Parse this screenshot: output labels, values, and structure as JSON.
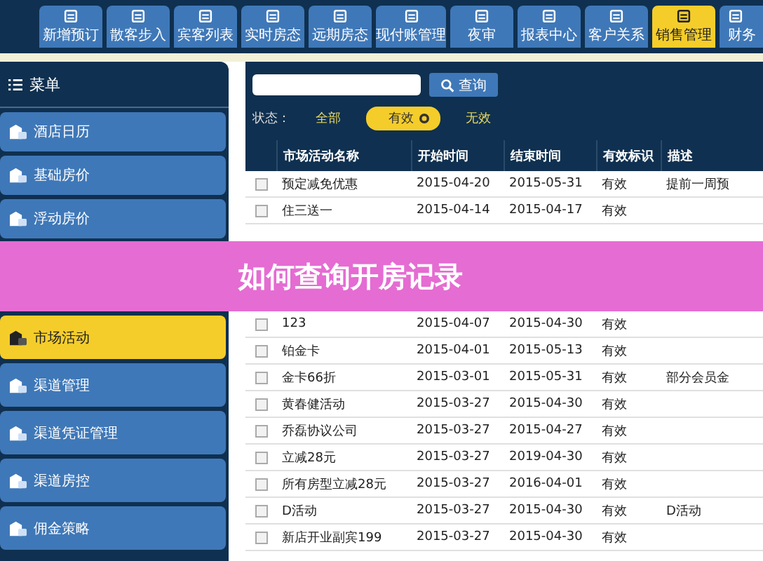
{
  "top_tabs": [
    {
      "label": "新增预订",
      "selected": false
    },
    {
      "label": "散客步入",
      "selected": false
    },
    {
      "label": "宾客列表",
      "selected": false
    },
    {
      "label": "实时房态",
      "selected": false
    },
    {
      "label": "远期房态",
      "selected": false
    },
    {
      "label": "现付账管理",
      "selected": false
    },
    {
      "label": "夜审",
      "selected": false
    },
    {
      "label": "报表中心",
      "selected": false
    },
    {
      "label": "客户关系",
      "selected": false
    },
    {
      "label": "销售管理",
      "selected": true
    },
    {
      "label": "财务",
      "selected": false
    }
  ],
  "sidebar": {
    "title": "菜单",
    "items": [
      {
        "label": "酒店日历",
        "selected": false
      },
      {
        "label": "基础房价",
        "selected": false
      },
      {
        "label": "浮动房价",
        "selected": false
      },
      {
        "label": "市场活动",
        "selected": true
      },
      {
        "label": "渠道管理",
        "selected": false
      },
      {
        "label": "渠道凭证管理",
        "selected": false
      },
      {
        "label": "渠道房控",
        "selected": false
      },
      {
        "label": "佣金策略",
        "selected": false
      }
    ]
  },
  "search": {
    "button": "查询"
  },
  "status_filter": {
    "label": "状态：",
    "options": [
      {
        "label": "全部",
        "selected": false
      },
      {
        "label": "有效",
        "selected": true
      },
      {
        "label": "无效",
        "selected": false
      }
    ]
  },
  "table": {
    "columns": [
      "市场活动名称",
      "开始时间",
      "结束时间",
      "有效标识",
      "描述"
    ],
    "rows": [
      {
        "checked": false,
        "cells": [
          "预定减免优惠",
          "2015-04-20",
          "2015-05-31",
          "有效",
          "提前一周预"
        ]
      },
      {
        "checked": false,
        "cells": [
          "住三送一",
          "2015-04-14",
          "2015-04-17",
          "有效",
          ""
        ]
      },
      {
        "checked": false,
        "cells": [
          "123",
          "2015-04-07",
          "2015-04-30",
          "有效",
          ""
        ]
      },
      {
        "checked": false,
        "cells": [
          "铂金卡",
          "2015-04-01",
          "2015-05-13",
          "有效",
          ""
        ]
      },
      {
        "checked": false,
        "cells": [
          "金卡66折",
          "2015-03-01",
          "2015-05-31",
          "有效",
          "部分会员金"
        ]
      },
      {
        "checked": false,
        "cells": [
          "黄春健活动",
          "2015-03-27",
          "2015-04-30",
          "有效",
          ""
        ]
      },
      {
        "checked": false,
        "cells": [
          "乔磊协议公司",
          "2015-03-27",
          "2015-04-27",
          "有效",
          ""
        ]
      },
      {
        "checked": false,
        "cells": [
          "立减28元",
          "2015-03-27",
          "2019-04-30",
          "有效",
          ""
        ]
      },
      {
        "checked": false,
        "cells": [
          "所有房型立减28元",
          "2015-03-27",
          "2016-04-01",
          "有效",
          ""
        ]
      },
      {
        "checked": false,
        "cells": [
          "D活动",
          "2015-03-27",
          "2015-04-30",
          "有效",
          "D活动"
        ]
      },
      {
        "checked": false,
        "cells": [
          "新店开业副宾199",
          "2015-03-27",
          "2015-04-30",
          "有效",
          ""
        ]
      }
    ]
  },
  "title_banner": "如何查询开房记录"
}
